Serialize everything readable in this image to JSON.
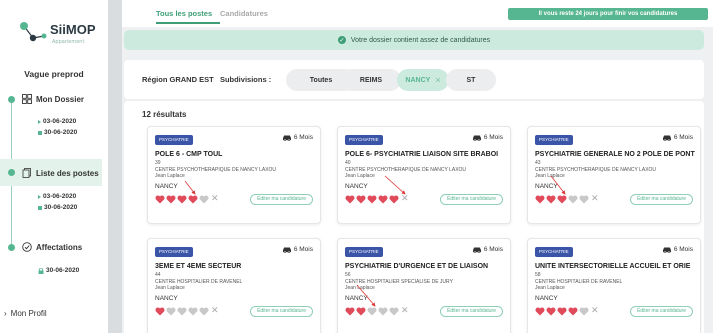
{
  "app": {
    "logo_text": "SiiMOP",
    "logo_sub": "Appariement"
  },
  "sidebar": {
    "wave": "Vague preprod",
    "sections": [
      {
        "label": "Mon Dossier",
        "dates": [
          "03-06-2020",
          "30-06-2020"
        ]
      },
      {
        "label": "Liste des postes",
        "dates": [
          "03-06-2020",
          "30-06-2020"
        ]
      },
      {
        "label": "Affectations",
        "dates": [
          "30-06-2020"
        ]
      }
    ],
    "profile": "Mon Profil"
  },
  "tabs": [
    {
      "label": "Tous les postes",
      "active": true
    },
    {
      "label": "Candidatures",
      "active": false
    }
  ],
  "deadline_notice": "Il vous reste 24 jours pour finir vos candidatures",
  "banner": "Votre dossier contient assez de candidatures",
  "filters": {
    "region": "Région GRAND EST",
    "subdivisions_label": "Subdivisions :",
    "options": [
      {
        "label": "Toutes",
        "selected": false
      },
      {
        "label": "REIMS",
        "selected": false
      },
      {
        "label": "NANCY",
        "selected": true
      },
      {
        "label": "ST",
        "selected": false
      }
    ]
  },
  "results_count": "12 résultats",
  "edit_label": "Éditer ma candidature",
  "colors": {
    "accent": "#56b692",
    "heart_filled": "#e04a5a",
    "heart_empty": "#c8c8c8",
    "badge": "#3a54a8"
  },
  "cards": [
    {
      "specialty": "PSYCHIATRIE",
      "duration": "6 Mois",
      "title": "POLE 6 - CMP TOUL",
      "number": "39",
      "institution": "CENTRE PSYCHOTHERAPIQUE DE NANCY LAXOU",
      "person": "Jean Laplace",
      "city": "NANCY",
      "rating": 4
    },
    {
      "specialty": "PSYCHIATRIE",
      "duration": "6 Mois",
      "title": "POLE 6- PSYCHIATRIE LIAISON SITE BRABOI",
      "number": "40",
      "institution": "CENTRE PSYCHOTHERAPIQUE DE NANCY LAXOU",
      "person": "Jean Laplace",
      "city": "NANCY",
      "rating": 5
    },
    {
      "specialty": "PSYCHIATRIE",
      "duration": "6 Mois",
      "title": "PSYCHIATRIE GENERALE NO 2 POLE DE PONT",
      "number": "43",
      "institution": "CENTRE PSYCHOTHERAPIQUE DE NANCY LAXOU",
      "person": "Jean Laplace",
      "city": "NANCY",
      "rating": 3
    },
    {
      "specialty": "PSYCHIATRIE",
      "duration": "6 Mois",
      "title": "3EME ET 4EME SECTEUR",
      "number": "44",
      "institution": "CENTRE HOSPITALIER DE RAVENEL",
      "person": "Jean Laplace",
      "city": "NANCY",
      "rating": 1
    },
    {
      "specialty": "PSYCHIATRIE",
      "duration": "6 Mois",
      "title": "PSYCHIATRIE D'URGENCE ET DE LIAISON",
      "number": "56",
      "institution": "CENTRE HOSPITALIER SPECIALISE DE JURY",
      "person": "Jean Laplace",
      "city": "NANCY",
      "rating": 2
    },
    {
      "specialty": "PSYCHIATRIE",
      "duration": "6 Mois",
      "title": "UNITE INTERSECTORIELLE ACCUEIL ET ORIE",
      "number": "58",
      "institution": "CENTRE HOSPITALIER DE RAVENEL",
      "person": "Jean Laplace",
      "city": "NANCY",
      "rating": 4
    }
  ]
}
